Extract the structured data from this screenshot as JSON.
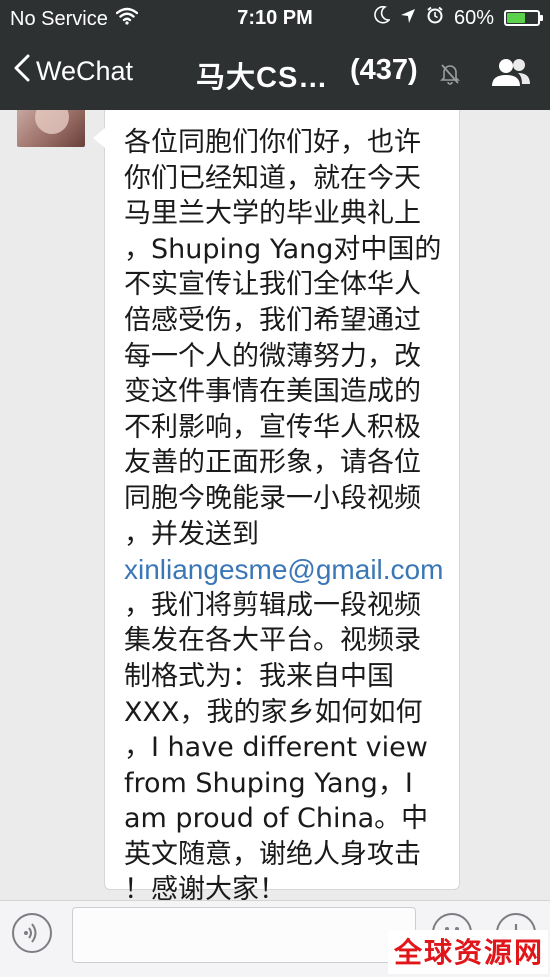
{
  "status_bar": {
    "carrier": "No Service",
    "time": "7:10 PM",
    "battery_percent": "60%",
    "battery_level": 0.6,
    "icons": [
      "wifi-icon",
      "moon-icon",
      "location-icon",
      "alarm-icon",
      "battery-icon"
    ]
  },
  "nav": {
    "back_label": "WeChat",
    "title": "马大CS…",
    "count": "(437)",
    "icons": [
      "chevron-left-icon",
      "mute-icon",
      "group-members-icon"
    ]
  },
  "message": {
    "lines_before": [
      "各位同胞们你们好，也许",
      "你们已经知道，就在今天",
      "马里兰大学的毕业典礼上",
      "，Shuping Yang对中国的",
      "不实宣传让我们全体华人",
      "倍感受伤，我们希望通过",
      "每一个人的微薄努力，改",
      "变这件事情在美国造成的",
      "不利影响，宣传华人积极",
      "友善的正面形象，请各位",
      "同胞今晚能录一小段视频",
      "，并发送到"
    ],
    "email": "xinliangesme@gmail.com",
    "lines_after": [
      "，我们将剪辑成一段视频",
      "集发在各大平台。视频录",
      "制格式为：我来自中国",
      "XXX，我的家乡如何如何",
      "，I have different view",
      "from Shuping Yang，I",
      "am proud of China。中",
      "英文随意，谢绝人身攻击",
      "！感谢大家！"
    ]
  },
  "input_bar": {
    "icons": [
      "voice-icon",
      "emoji-icon",
      "plus-icon"
    ]
  },
  "watermark": {
    "text": "全球资源网"
  },
  "colors": {
    "header_bg": "#2e3132",
    "chat_bg": "#ebebeb",
    "bubble_bg": "#ffffff",
    "link": "#3b77b6",
    "battery": "#5bd24b",
    "watermark": "#e0161b"
  }
}
